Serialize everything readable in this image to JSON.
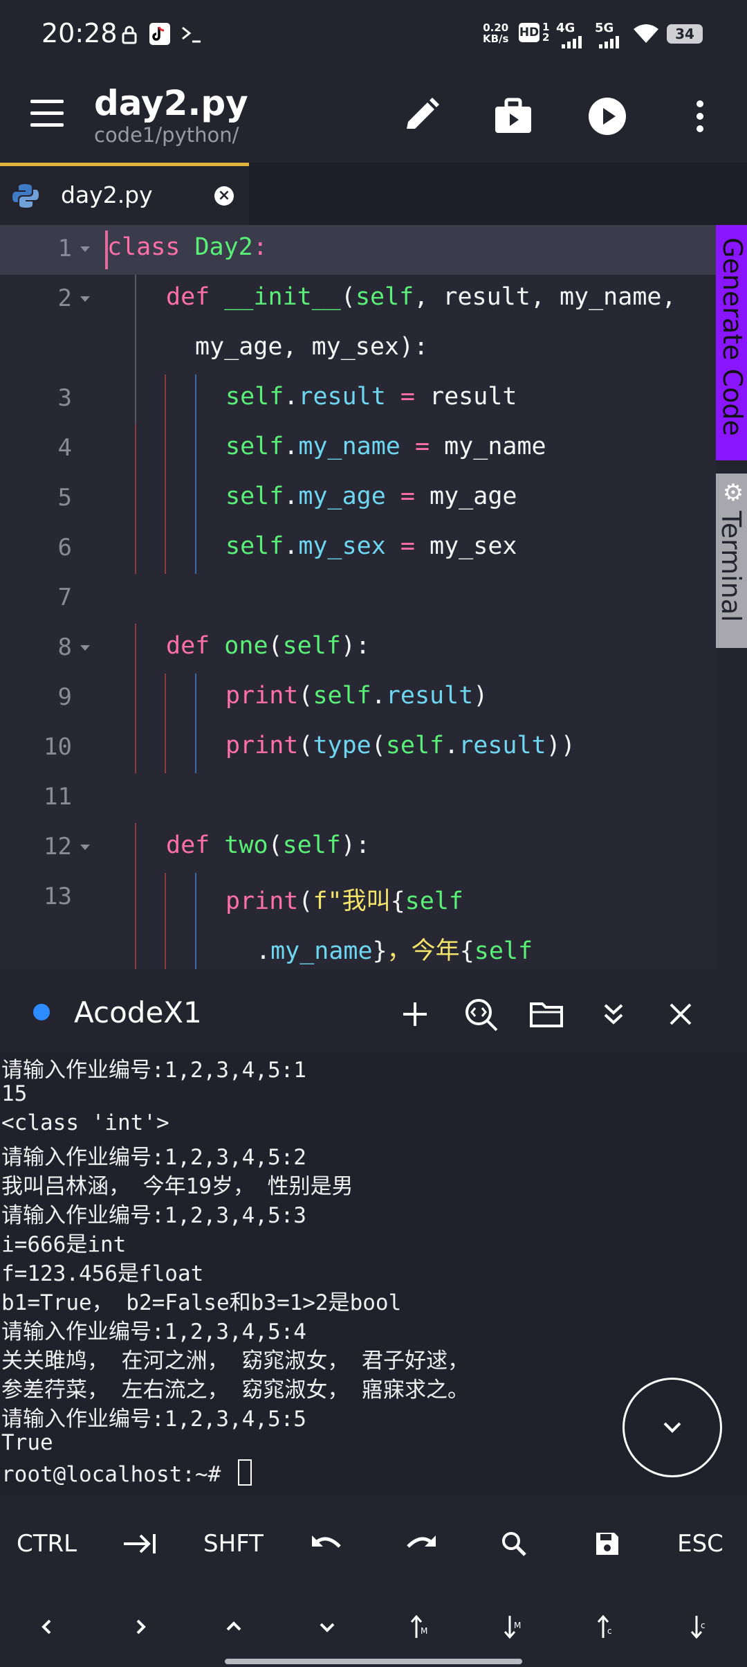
{
  "status_bar": {
    "time": "20:28",
    "net_speed_top": "0.20",
    "net_speed_bottom": "KB/s",
    "hd": "HD",
    "net_4g": "4G",
    "net_5g": "5G",
    "battery": "34",
    "icons": [
      "lock-icon",
      "tiktok-icon",
      "terminal-prompt-icon",
      "signal-4g-icon",
      "signal-5g-icon",
      "wifi-icon",
      "battery-icon"
    ]
  },
  "app_bar": {
    "title": "day2.py",
    "path": "code1/python/",
    "actions": [
      "menu-icon",
      "edit-icon",
      "build-icon",
      "run-icon",
      "more-icon"
    ]
  },
  "tab": {
    "label": "day2.py"
  },
  "editor": {
    "active_line": 1,
    "lines": [
      {
        "n": "1",
        "fold": true
      },
      {
        "n": "2",
        "fold": true
      },
      {
        "n": "",
        "fold": false
      },
      {
        "n": "3",
        "fold": false
      },
      {
        "n": "4",
        "fold": false
      },
      {
        "n": "5",
        "fold": false
      },
      {
        "n": "6",
        "fold": false
      },
      {
        "n": "7",
        "fold": false
      },
      {
        "n": "8",
        "fold": true
      },
      {
        "n": "9",
        "fold": false
      },
      {
        "n": "10",
        "fold": false
      },
      {
        "n": "11",
        "fold": false
      },
      {
        "n": "12",
        "fold": true
      },
      {
        "n": "13",
        "fold": false
      },
      {
        "n": "",
        "fold": false
      }
    ],
    "tokens": [
      {
        "t": "class",
        "c": "Day2",
        "p": ":"
      },
      {
        "def": "def",
        "fn": "__init__",
        "open": "(",
        "self": "self",
        "args": ", result, my_name,"
      },
      {
        "cont": "my_age, my_sex):"
      },
      {
        "self": "self",
        "dot": ".",
        "attr": "result",
        "eq": " = ",
        "val": "result"
      },
      {
        "self": "self",
        "dot": ".",
        "attr": "my_name",
        "eq": " = ",
        "val": "my_name"
      },
      {
        "self": "self",
        "dot": ".",
        "attr": "my_age",
        "eq": " = ",
        "val": "my_age"
      },
      {
        "self": "self",
        "dot": ".",
        "attr": "my_sex",
        "eq": " = ",
        "val": "my_sex"
      },
      {},
      {
        "def": "def",
        "fn": "one",
        "open": "(",
        "self": "self",
        "close": "):"
      },
      {
        "print": "print",
        "open": "(",
        "self": "self",
        "dot": ".",
        "attr": "result",
        "close": ")"
      },
      {
        "print": "print",
        "open": "(",
        "type": "type",
        "open2": "(",
        "self": "self",
        "dot": ".",
        "attr": "result",
        "close": "))"
      },
      {},
      {
        "def": "def",
        "fn": "two",
        "open": "(",
        "self": "self",
        "close": "):"
      },
      {
        "print": "print",
        "open": "(",
        "fstr": "f\"我叫",
        "brace": "{",
        "self": "self"
      },
      {
        "dot": ".",
        "attr": "my_name",
        "brace_close": "}",
        "str2": "，今年",
        "brace2": "{",
        "self": "self"
      }
    ]
  },
  "side_tabs": {
    "generate": "Generate Code",
    "terminal": "Terminal"
  },
  "terminal": {
    "title": "AcodeX1",
    "actions": [
      "add-icon",
      "search-code-icon",
      "folder-icon",
      "collapse-icon",
      "close-icon"
    ],
    "output": [
      "请输入作业编号:1,2,3,4,5:1",
      "15",
      "<class 'int'>",
      "请输入作业编号:1,2,3,4,5:2",
      "我叫吕林涵， 今年19岁， 性别是男",
      "请输入作业编号:1,2,3,4,5:3",
      "i=666是int",
      "f=123.456是float",
      "b1=True， b2=False和b3=1>2是bool",
      "请输入作业编号:1,2,3,4,5:4",
      "关关雎鸠， 在河之洲， 窈窕淑女， 君子好逑，",
      "参差荇菜， 左右流之， 窈窕淑女， 寤寐求之。",
      "请输入作业编号:1,2,3,4,5:5",
      "True"
    ],
    "prompt": "root@localhost:~# "
  },
  "extra_keys": {
    "row1": [
      "CTRL",
      "tab-icon",
      "SHFT",
      "undo-icon",
      "redo-icon",
      "search-icon",
      "save-icon",
      "ESC"
    ],
    "row2": [
      "arrow-left-icon",
      "arrow-right-icon",
      "arrow-up-icon",
      "arrow-down-icon",
      "page-up-icon",
      "page-down-icon",
      "cursor-top-icon",
      "cursor-bottom-icon"
    ],
    "labels": {
      "ctrl": "CTRL",
      "shft": "SHFT",
      "esc": "ESC"
    }
  },
  "colors": {
    "keyword": "#ff6fa8",
    "function": "#5af078",
    "attribute": "#6ed6f0",
    "string": "#f4e46a",
    "accent_tab": "#e0b43c",
    "generate_tab": "#8a16ff"
  }
}
